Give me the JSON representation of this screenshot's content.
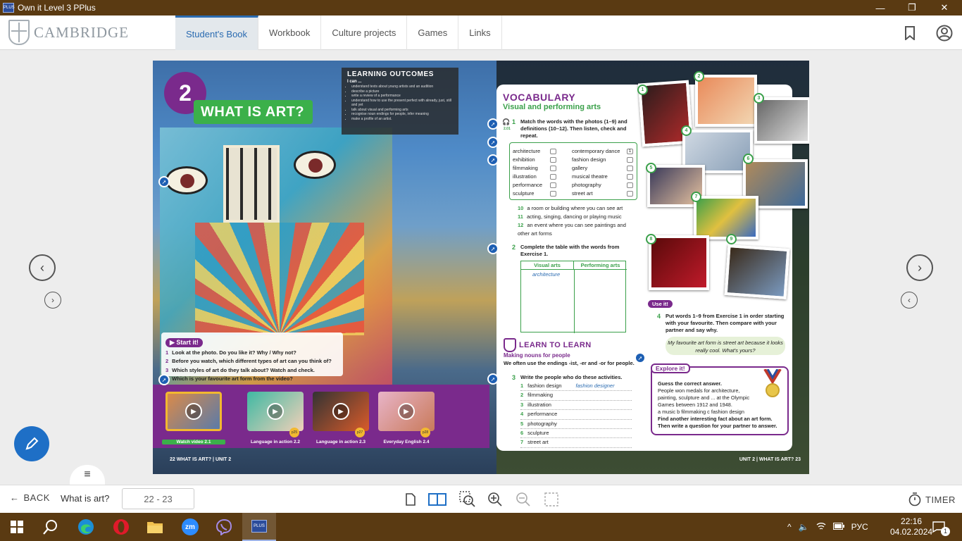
{
  "window": {
    "title": "Own it Level 3 PPlus",
    "app_icon_text": "PLUS",
    "minimize": "—",
    "restore": "❐",
    "close": "✕"
  },
  "header": {
    "logo_text": "CAMBRIDGE",
    "tabs": [
      {
        "label": "Student's Book",
        "active": true
      },
      {
        "label": "Workbook"
      },
      {
        "label": "Culture projects"
      },
      {
        "label": "Games"
      },
      {
        "label": "Links"
      }
    ]
  },
  "book": {
    "left": {
      "unit_number": "2",
      "unit_title": "WHAT IS ART?",
      "outcomes_title": "LEARNING OUTCOMES",
      "outcomes_can": "I can ...",
      "outcomes": [
        "understand texts about young artists and an audition",
        "describe a picture",
        "write a review of a performance",
        "understand how to use the present perfect with already, just, still and yet",
        "talk about visual and performing arts",
        "recognise noun endings for people, infer meaning",
        "make a profile of an artist."
      ],
      "start_it": "Start it!",
      "start_questions": [
        {
          "n": "1",
          "t": "Look at the photo. Do you like it? Why / Why not?"
        },
        {
          "n": "2",
          "t": "Before you watch, which different types of art can you think of?"
        },
        {
          "n": "3",
          "t": "Which styles of art do they talk about? Watch and check."
        },
        {
          "n": "4",
          "t": "Which is your favourite art form from the video?"
        }
      ],
      "videos": [
        {
          "label": "Watch video 2.1",
          "badge": ""
        },
        {
          "label": "Language in action 2.2",
          "badge": "p25"
        },
        {
          "label": "Language in action 2.3",
          "badge": "p27"
        },
        {
          "label": "Everyday English 2.4",
          "badge": "p28"
        }
      ],
      "footer": "22  WHAT IS ART? | UNIT 2"
    },
    "right": {
      "vocab_title": "VOCABULARY",
      "vocab_subtitle": "Visual and performing arts",
      "ex1_audio": "2.01",
      "ex1_num": "1",
      "ex1": "Match the words with the photos (1–9) and definitions (10–12). Then listen, check and repeat.",
      "words_left": [
        "architecture",
        "exhibition",
        "filmmaking",
        "illustration",
        "performance",
        "sculpture"
      ],
      "words_right": [
        "contemporary dance",
        "fashion design",
        "gallery",
        "musical theatre",
        "photography",
        "street art"
      ],
      "first_answer": "1",
      "definitions": [
        {
          "n": "10",
          "t": "a room or building where you can see art"
        },
        {
          "n": "11",
          "t": "acting, singing, dancing or playing music"
        },
        {
          "n": "12",
          "t": "an event where you can see paintings and other art forms"
        }
      ],
      "ex2_num": "2",
      "ex2": "Complete the table with the words from Exercise 1.",
      "table_headers": [
        "Visual arts",
        "Performing arts"
      ],
      "table_example": "architecture",
      "l2l_title": "LEARN TO LEARN",
      "l2l_subtitle": "Making nouns for people",
      "l2l_text": "We often use the endings -ist, -er and -or for people.",
      "ex3_num": "3",
      "ex3": "Write the people who do these activities.",
      "ex3_items": [
        {
          "n": "1",
          "t": "fashion design",
          "a": "fashion designer"
        },
        {
          "n": "2",
          "t": "filmmaking",
          "a": ""
        },
        {
          "n": "3",
          "t": "illustration",
          "a": ""
        },
        {
          "n": "4",
          "t": "performance",
          "a": ""
        },
        {
          "n": "5",
          "t": "photography",
          "a": ""
        },
        {
          "n": "6",
          "t": "sculpture",
          "a": ""
        },
        {
          "n": "7",
          "t": "street art",
          "a": ""
        }
      ],
      "use_it": "Use it!",
      "ex4_num": "4",
      "ex4": "Put words 1–9 from Exercise 1 in order starting with your favourite. Then compare with your partner and say why.",
      "speech": "My favourite art form is street art because it looks really cool. What's yours?",
      "explore_title": "Explore it!",
      "explore_q": "Guess the correct answer.",
      "explore_text": "People won medals for architecture, painting, sculpture and ... at the Olympic Games between 1912 and 1948.",
      "explore_options": "a  music     b  filmmaking     c  fashion design",
      "explore_task": "Find another interesting fact about an art form. Then write a question for your partner to answer.",
      "photo_numbers": [
        "1",
        "2",
        "3",
        "4",
        "5",
        "6",
        "7",
        "8",
        "9"
      ],
      "footer": "UNIT 2 | WHAT IS ART?  23"
    }
  },
  "bottom": {
    "back": "BACK",
    "chapter": "What is art?",
    "page_range": "22 - 23",
    "timer": "TIMER"
  },
  "taskbar": {
    "zoom_label": "zm",
    "lang": "РУС",
    "time": "22:16",
    "date": "04.02.2024",
    "notifications": "1"
  }
}
